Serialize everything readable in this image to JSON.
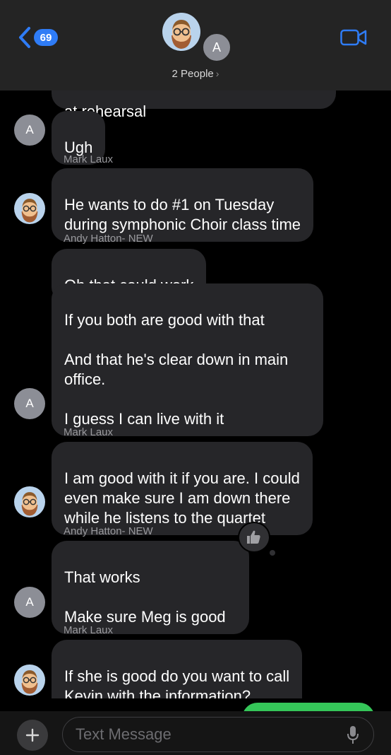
{
  "header": {
    "back_count": "69",
    "people_label": "2 People",
    "people_chevron": "›",
    "secondary_avatar_initial": "A"
  },
  "thread": {
    "partial_top_text": "at rehearsal",
    "messages": [
      {
        "text": "Ugh"
      },
      {
        "sender": "Mark Laux",
        "text": "He wants to do #1 on Tuesday\nduring symphonic Choir class time"
      },
      {
        "sender": "Andy Hatton- NEW",
        "text": "Oh that could work"
      },
      {
        "text": "If you both are good with that\n\nAnd that he's clear down in main\noffice.\n\nI guess I can live with it"
      },
      {
        "sender": "Mark Laux",
        "text": "I am good with it if you are. I could\neven make sure I am down there\nwhile he listens to the quartet"
      },
      {
        "sender": "Andy Hatton- NEW",
        "text": "That works\n\nMake sure Meg is good",
        "tapback": "thumbs-up"
      },
      {
        "sender": "Mark Laux",
        "text": "If she is good do you want to call\nKevin with the information?"
      }
    ],
    "avatar_initial": "A"
  },
  "composer": {
    "placeholder": "Text Message"
  },
  "colors": {
    "accent": "#2f7cf6",
    "incoming_bubble": "#262629",
    "outgoing_bubble": "#35c659",
    "header_bg": "#242424"
  },
  "icons": [
    "back-chevron-icon",
    "video-call-icon",
    "memoji-avatar-icon",
    "thumbs-up-icon",
    "plus-icon",
    "microphone-icon"
  ]
}
